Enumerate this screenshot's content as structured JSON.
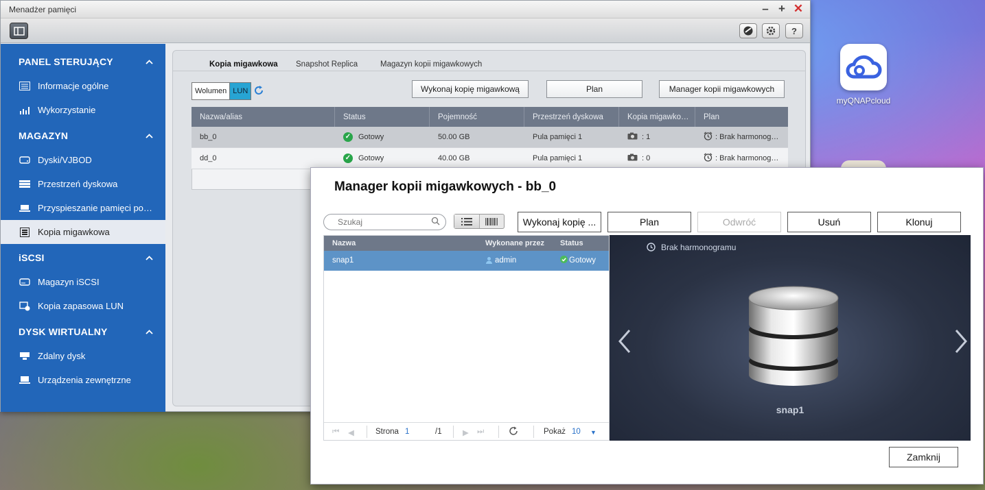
{
  "main_window": {
    "title": "Menadżer pamięci",
    "sidebar": [
      {
        "type": "section",
        "label": "PANEL STERUJĄCY"
      },
      {
        "type": "item",
        "label": "Informacje ogólne",
        "icon": "info-list-icon"
      },
      {
        "type": "item",
        "label": "Wykorzystanie",
        "icon": "usage-chart-icon"
      },
      {
        "type": "section",
        "label": "MAGAZYN"
      },
      {
        "type": "item",
        "label": "Dyski/VJBOD",
        "icon": "disk-icon"
      },
      {
        "type": "item",
        "label": "Przestrzeń dyskowa",
        "icon": "storage-space-icon"
      },
      {
        "type": "item",
        "label": "Przyspieszanie pamięci po…",
        "icon": "cache-icon"
      },
      {
        "type": "item",
        "label": "Kopia migawkowa",
        "icon": "snapshot-icon",
        "active": true
      },
      {
        "type": "section",
        "label": "iSCSI"
      },
      {
        "type": "item",
        "label": "Magazyn iSCSI",
        "icon": "iscsi-storage-icon"
      },
      {
        "type": "item",
        "label": "Kopia zapasowa LUN",
        "icon": "lun-backup-icon"
      },
      {
        "type": "section",
        "label": "DYSK WIRTUALNY"
      },
      {
        "type": "item",
        "label": "Zdalny dysk",
        "icon": "remote-disk-icon"
      },
      {
        "type": "item",
        "label": "Urządzenia zewnętrzne",
        "icon": "external-device-icon"
      }
    ],
    "tabs": [
      "Kopia migawkowa",
      "Snapshot Replica",
      "Magazyn kopii migawkowych"
    ],
    "segment": {
      "volume": "Wolumen",
      "lun": "LUN"
    },
    "buttons": {
      "take_snapshot": "Wykonaj kopię migawkową",
      "schedule": "Plan",
      "manager": "Manager kopii migawkowych"
    },
    "grid": {
      "columns": [
        "Nazwa/alias",
        "Status",
        "Pojemność",
        "Przestrzeń dyskowa",
        "Kopia migawko…",
        "Plan"
      ],
      "rows": [
        {
          "name": "bb_0",
          "status": "Gotowy",
          "capacity": "50.00 GB",
          "pool": "Pula pamięci 1",
          "snapshots": ": 1",
          "plan": ": Brak harmonog…"
        },
        {
          "name": "dd_0",
          "status": "Gotowy",
          "capacity": "40.00 GB",
          "pool": "Pula pamięci 1",
          "snapshots": ": 0",
          "plan": ": Brak harmonog…"
        }
      ]
    }
  },
  "desktop": {
    "cloud_label": "myQNAPcloud"
  },
  "dialog": {
    "title": "Manager kopii migawkowych - bb_0",
    "search_placeholder": "Szukaj",
    "buttons": {
      "take": "Wykonaj kopię ...",
      "plan": "Plan",
      "revert": "Odwróć",
      "delete": "Usuń",
      "clone": "Klonuj",
      "close": "Zamknij"
    },
    "list": {
      "columns": {
        "name": "Nazwa",
        "by": "Wykonane przez",
        "status": "Status"
      },
      "rows": [
        {
          "name": "snap1",
          "by": "admin",
          "status": "Gotowy"
        }
      ]
    },
    "pager": {
      "page_label": "Strona",
      "page": "1",
      "total": "/1",
      "show_label": "Pokaż",
      "show_value": "10"
    },
    "preview": {
      "schedule": "Brak harmonogramu",
      "snapshot_name": "snap1"
    }
  }
}
